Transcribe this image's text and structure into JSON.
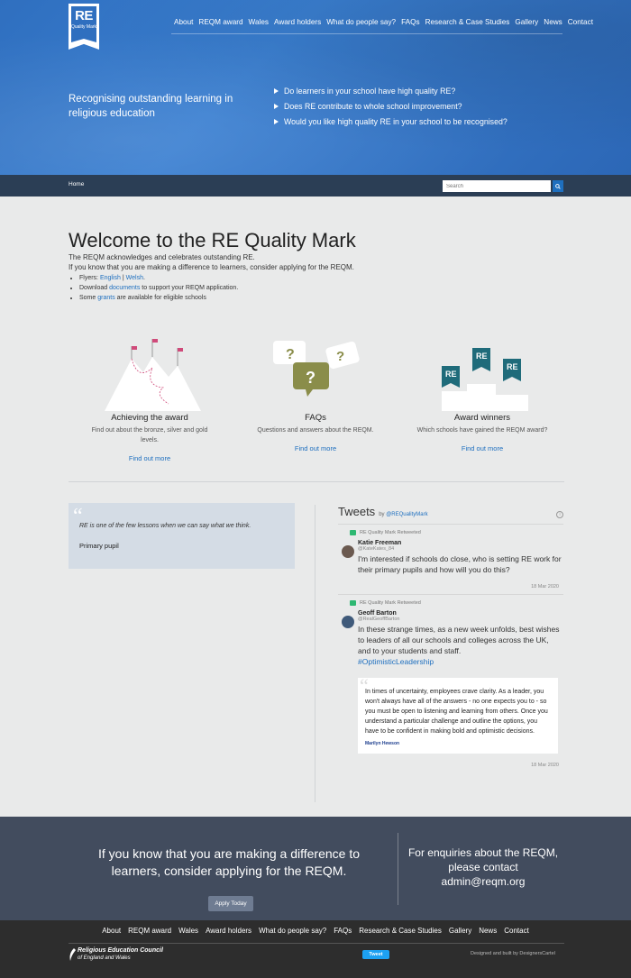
{
  "brand": {
    "logo_main": "RE",
    "logo_sub": "Quality Mark"
  },
  "nav": [
    "About",
    "REQM award",
    "Wales",
    "Award holders",
    "What do people say?",
    "FAQs",
    "Research & Case Studies",
    "Gallery",
    "News",
    "Contact"
  ],
  "hero": {
    "tagline": "Recognising outstanding learning in religious education",
    "questions": [
      "Do learners in your school have high quality RE?",
      "Does RE contribute to whole school improvement?",
      "Would you like high quality RE in your school to be recognised?"
    ]
  },
  "breadcrumb": {
    "home": "Home",
    "search_placeholder": "Search"
  },
  "welcome": {
    "title": "Welcome to the RE Quality Mark",
    "line1": "The REQM acknowledges and celebrates outstanding RE.",
    "line2": "If you know that you are making a difference to learners, consider applying for the REQM.",
    "flyers_prefix": "Flyers: ",
    "flyers_english": "English",
    "flyers_sep": " | ",
    "flyers_welsh": "Welsh",
    "flyers_end": ".",
    "download_prefix": "Download ",
    "download_link": "documents",
    "download_suffix": " to support your REQM application.",
    "grants_prefix": "Some ",
    "grants_link": "grants",
    "grants_suffix": " are available for eligible schools"
  },
  "features": [
    {
      "title": "Achieving the award",
      "desc": "Find out about the bronze, silver and gold levels.",
      "link": "Find out more"
    },
    {
      "title": "FAQs",
      "desc": "Questions and answers about the REQM.",
      "link": "Find out more"
    },
    {
      "title": "Award winners",
      "desc": "Which schools have gained the REQM award?",
      "link": "Find out more"
    }
  ],
  "quote": {
    "text": "RE is one of the few lessons when we can say what we think.",
    "author": "Primary pupil"
  },
  "tweets": {
    "title": "Tweets",
    "by": "by",
    "handle": "@REQualityMark",
    "items": [
      {
        "retweet": "RE Quality Mark Retweeted",
        "name": "Katie Freeman",
        "handle": "@KateKates_84",
        "text": "I'm interested if schools do close, who is setting RE work for their primary pupils and how will you do this?",
        "date": "18 Mar 2020"
      },
      {
        "retweet": "RE Quality Mark Retweeted",
        "name": "Geoff Barton",
        "handle": "@RealGeoffBarton",
        "text": "In these strange times, as a new week unfolds, best wishes to leaders of all our schools and colleges across the UK, and to your students and staff.",
        "hashtag": "#OptimisticLeadership",
        "embed_text": "In times of uncertainty, employees crave clarity. As a leader, you won't always have all of the answers - no one expects you to - so you must be open to listening and learning from others. Once you understand a particular challenge and outline the options, you have to be confident in making bold and optimistic decisions.",
        "embed_author": "Marilyn Hewson",
        "date": "18 Mar 2020"
      }
    ]
  },
  "cta": {
    "left": "If you know that you are making a difference to learners, consider applying for the REQM.",
    "button": "Apply Today",
    "right_line1": "For enquiries about the REQM, please contact",
    "right_email": "admin@reqm.org"
  },
  "footer": {
    "org_line1": "Religious Education Council",
    "org_line2": "of England and Wales",
    "tweet_button": "Tweet",
    "credit": "Designed and built by DesignersCartel"
  }
}
